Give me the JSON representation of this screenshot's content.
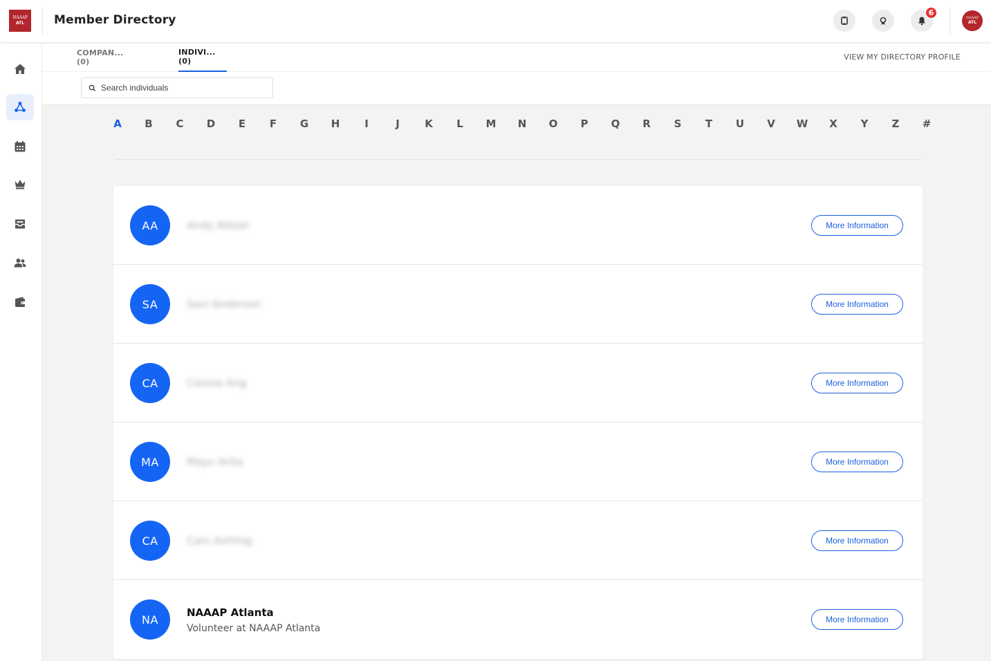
{
  "app": {
    "logo_line1": "NAAAP",
    "logo_line2": "ATL",
    "title": "Member Directory",
    "notifications_count": "6",
    "brand_color": "#b3262d",
    "accent_color": "#1565f5"
  },
  "tabs": [
    {
      "label": "COMPAN... (0)",
      "active": false
    },
    {
      "label": "INDIVI... (0)",
      "active": true
    }
  ],
  "view_profile_label": "VIEW MY DIRECTORY PROFILE",
  "search": {
    "placeholder": "Search individuals",
    "value": ""
  },
  "alphabet": [
    "A",
    "B",
    "C",
    "D",
    "E",
    "F",
    "G",
    "H",
    "I",
    "J",
    "K",
    "L",
    "M",
    "N",
    "O",
    "P",
    "Q",
    "R",
    "S",
    "T",
    "U",
    "V",
    "W",
    "X",
    "Y",
    "Z",
    "#"
  ],
  "alphabet_active": "A",
  "sidebar": [
    {
      "icon": "home-icon",
      "active": false
    },
    {
      "icon": "network-icon",
      "active": true
    },
    {
      "icon": "calendar-icon",
      "active": false
    },
    {
      "icon": "crown-icon",
      "active": false
    },
    {
      "icon": "inbox-icon",
      "active": false
    },
    {
      "icon": "people-icon",
      "active": false
    },
    {
      "icon": "wallet-icon",
      "active": false
    }
  ],
  "members": [
    {
      "initials": "AA",
      "name": "Andy Altizer",
      "subtitle": "",
      "blurred": true
    },
    {
      "initials": "SA",
      "name": "Savi Anderson",
      "subtitle": "",
      "blurred": true
    },
    {
      "initials": "CA",
      "name": "Connie Ang",
      "subtitle": "",
      "blurred": true
    },
    {
      "initials": "MA",
      "name": "Mayu Arita",
      "subtitle": "",
      "blurred": true
    },
    {
      "initials": "CA",
      "name": "Cam Ashling",
      "subtitle": "",
      "blurred": true
    },
    {
      "initials": "NA",
      "name": "NAAAP Atlanta",
      "subtitle": "Volunteer at NAAAP Atlanta",
      "blurred": false
    }
  ],
  "more_info_label": "More Information"
}
